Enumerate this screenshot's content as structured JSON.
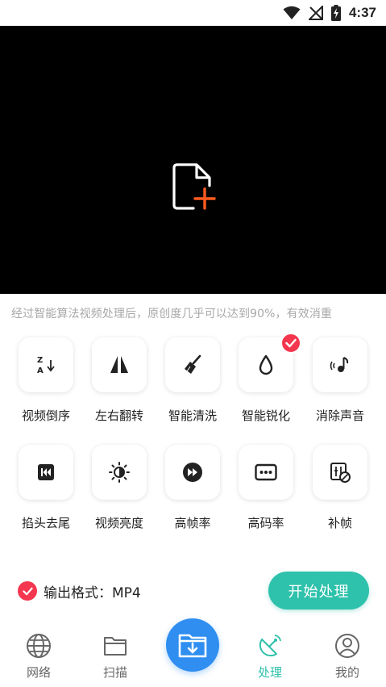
{
  "status_bar": {
    "time": "4:37"
  },
  "hint": "经过智能算法视频处理后，原创度几乎可以达到90%，有效消重",
  "tools": [
    {
      "label": "视频倒序",
      "icon": "reverse-sort-icon",
      "selected": false
    },
    {
      "label": "左右翻转",
      "icon": "mirror-flip-icon",
      "selected": false
    },
    {
      "label": "智能清洗",
      "icon": "broom-icon",
      "selected": false
    },
    {
      "label": "智能锐化",
      "icon": "droplet-icon",
      "selected": true
    },
    {
      "label": "消除声音",
      "icon": "mute-sound-icon",
      "selected": false
    },
    {
      "label": "掐头去尾",
      "icon": "trim-ends-icon",
      "selected": false
    },
    {
      "label": "视频亮度",
      "icon": "brightness-icon",
      "selected": false
    },
    {
      "label": "高帧率",
      "icon": "fast-forward-icon",
      "selected": false
    },
    {
      "label": "高码率",
      "icon": "bitrate-icon",
      "selected": false
    },
    {
      "label": "补帧",
      "icon": "frame-fill-icon",
      "selected": false
    }
  ],
  "output_format": {
    "label": "输出格式：MP4"
  },
  "start_button": {
    "label": "开始处理"
  },
  "tabs": [
    {
      "label": "网络",
      "icon": "globe-icon",
      "active": false
    },
    {
      "label": "扫描",
      "icon": "folder-icon",
      "active": false
    },
    {
      "label": "",
      "icon": "download-folder-icon",
      "active": false
    },
    {
      "label": "处理",
      "icon": "satellite-dish-icon",
      "active": true
    },
    {
      "label": "我的",
      "icon": "user-profile-icon",
      "active": false
    }
  ],
  "colors": {
    "accent": "#2ec1ab",
    "badge": "#f4374e",
    "center_tab": "#2f8ef0",
    "add_plus": "#ff5a1f"
  }
}
